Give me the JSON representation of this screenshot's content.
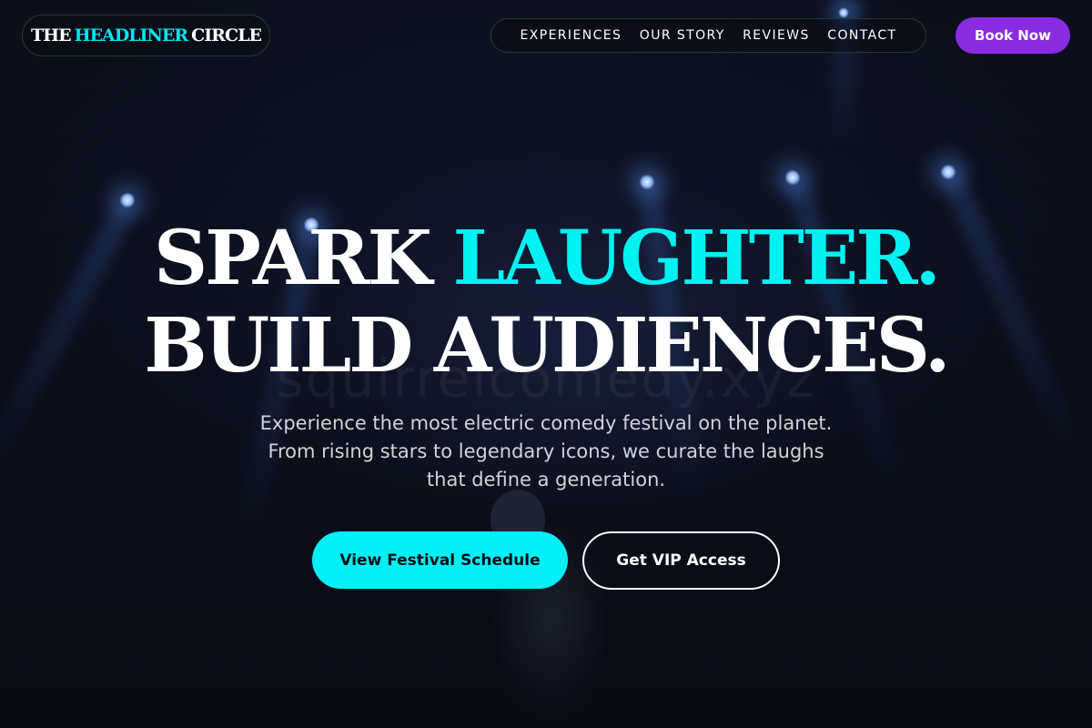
{
  "brand": {
    "logo_part1": "THE",
    "logo_part2": "HEADLINER",
    "logo_part3": "CIRCLE",
    "accent_color": "#00f2f2",
    "cta_color": "#8a2be2"
  },
  "nav": {
    "items": [
      {
        "label": "EXPERIENCES"
      },
      {
        "label": "OUR STORY"
      },
      {
        "label": "REVIEWS"
      },
      {
        "label": "CONTACT"
      }
    ],
    "book_label": "Book Now"
  },
  "hero": {
    "line1_white": "SPARK",
    "line1_accent": "LAUGHTER.",
    "line2": "BUILD AUDIENCES.",
    "subtitle_line1": "Experience the most electric comedy festival on the planet.",
    "subtitle_line2": "From rising stars to legendary icons, we curate the laughs",
    "subtitle_line3": "that define a generation.",
    "primary_cta": "View Festival Schedule",
    "secondary_cta": "Get VIP Access",
    "watermark": "squirrelcomedy.xyz"
  }
}
